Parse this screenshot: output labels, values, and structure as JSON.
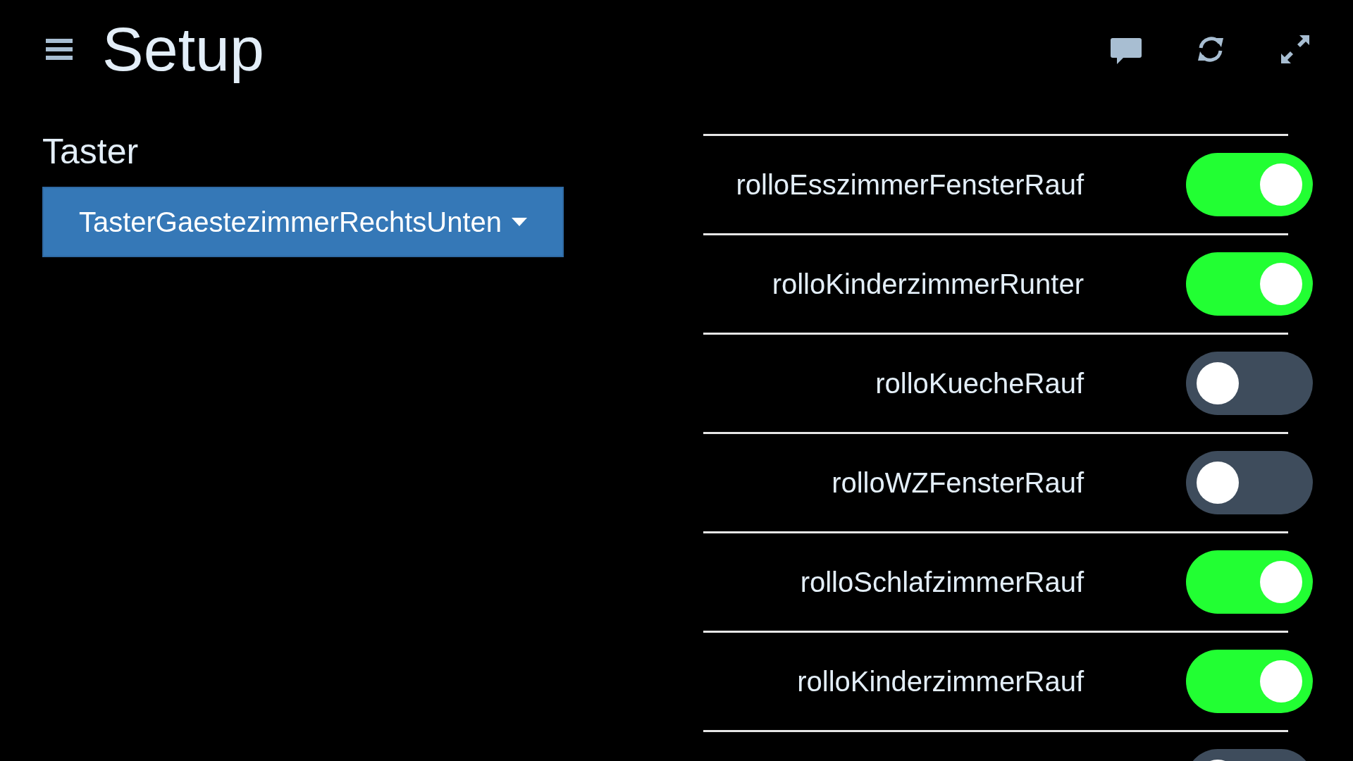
{
  "header": {
    "title": "Setup"
  },
  "left": {
    "label": "Taster",
    "dropdown": {
      "value": "TasterGaestezimmerRechtsUnten"
    }
  },
  "switches": [
    {
      "label": "rolloEsszimmerFensterRauf",
      "on": true
    },
    {
      "label": "rolloKinderzimmerRunter",
      "on": true
    },
    {
      "label": "rolloKuecheRauf",
      "on": false
    },
    {
      "label": "rolloWZFensterRauf",
      "on": false
    },
    {
      "label": "rolloSchlafzimmerRauf",
      "on": true
    },
    {
      "label": "rolloKinderzimmerRauf",
      "on": true
    },
    {
      "on": false
    }
  ]
}
